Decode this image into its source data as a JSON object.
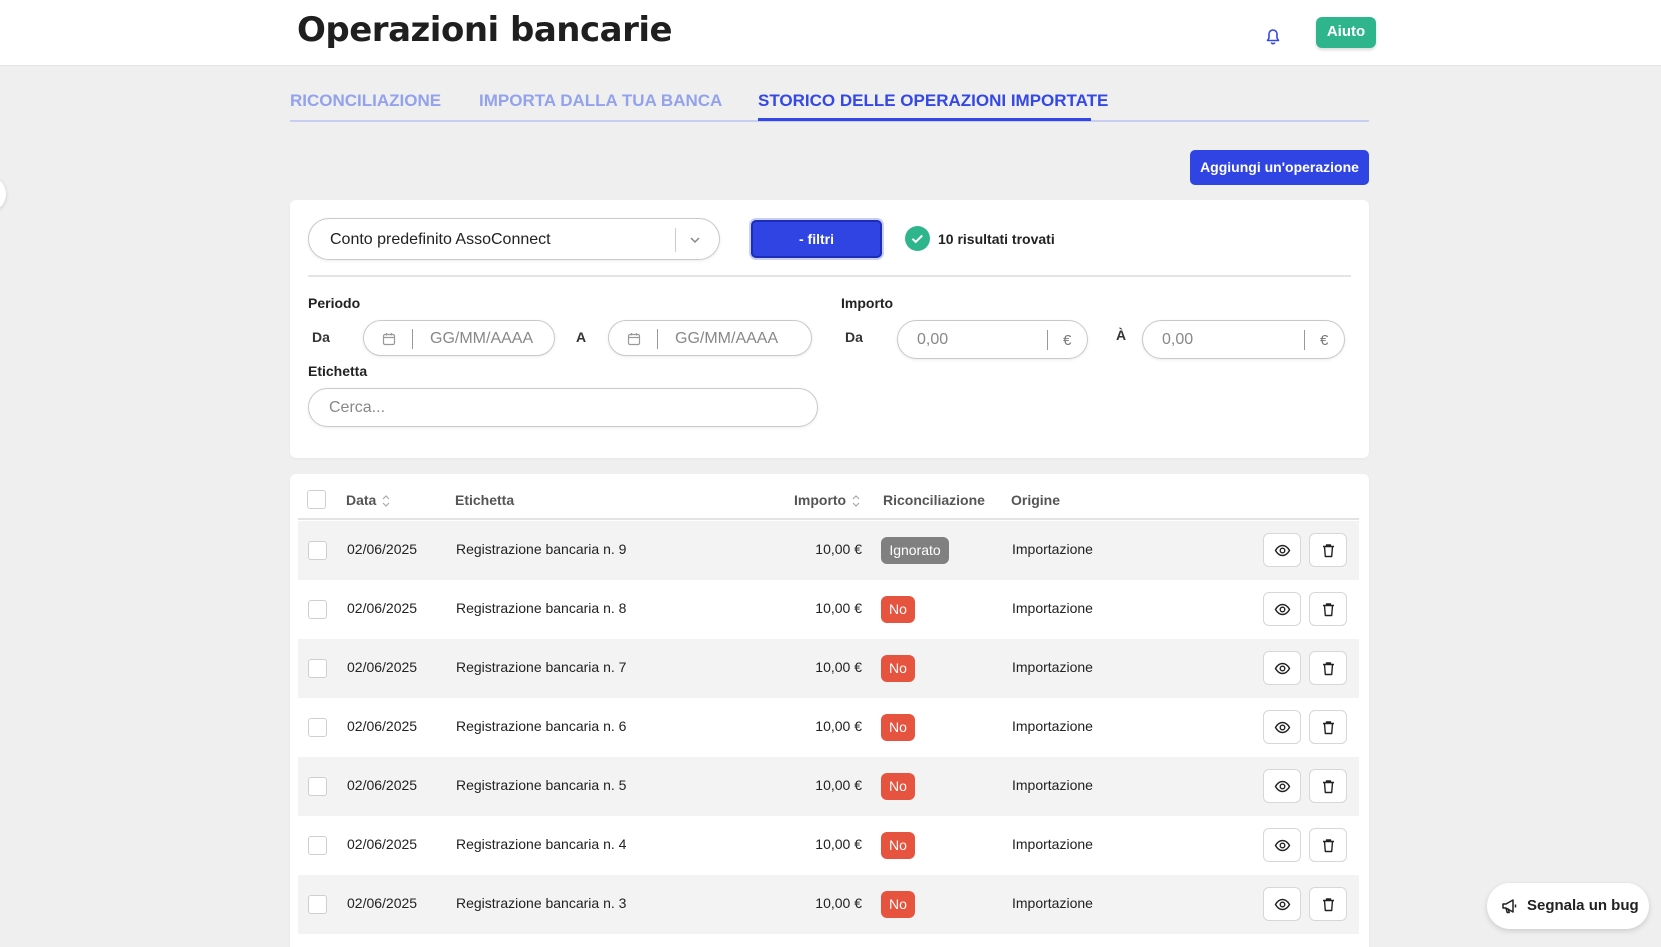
{
  "header": {
    "title": "Operazioni bancarie",
    "help_label": "Aiuto"
  },
  "tabs": [
    {
      "label": "RICONCILIAZIONE",
      "active": false
    },
    {
      "label": "IMPORTA DALLA TUA BANCA",
      "active": false
    },
    {
      "label": "STORICO DELLE OPERAZIONI IMPORTATE",
      "active": true
    }
  ],
  "actions": {
    "add_operation_label": "Aggiungi un'operazione"
  },
  "filters": {
    "account_selected": "Conto predefinito AssoConnect",
    "toggle_label": "- filtri",
    "results_text": "10 risultati trovati",
    "period_label": "Periodo",
    "from_label": "Da",
    "to_label": "A",
    "date_placeholder": "GG/MM/AAAA",
    "amount_label": "Importo",
    "amount_from_label": "Da",
    "amount_to_label": "À",
    "amount_placeholder": "0,00",
    "currency": "€",
    "tag_label": "Etichetta",
    "tag_placeholder": "Cerca..."
  },
  "table": {
    "columns": {
      "date": "Data",
      "label": "Etichetta",
      "amount": "Importo",
      "reconciliation": "Riconciliazione",
      "origin": "Origine"
    },
    "rows": [
      {
        "date": "02/06/2025",
        "label": "Registrazione bancaria n. 9",
        "amount": "10,00 €",
        "status": "Ignorato",
        "status_type": "ignored",
        "origin": "Importazione"
      },
      {
        "date": "02/06/2025",
        "label": "Registrazione bancaria n. 8",
        "amount": "10,00 €",
        "status": "No",
        "status_type": "no",
        "origin": "Importazione"
      },
      {
        "date": "02/06/2025",
        "label": "Registrazione bancaria n. 7",
        "amount": "10,00 €",
        "status": "No",
        "status_type": "no",
        "origin": "Importazione"
      },
      {
        "date": "02/06/2025",
        "label": "Registrazione bancaria n. 6",
        "amount": "10,00 €",
        "status": "No",
        "status_type": "no",
        "origin": "Importazione"
      },
      {
        "date": "02/06/2025",
        "label": "Registrazione bancaria n. 5",
        "amount": "10,00 €",
        "status": "No",
        "status_type": "no",
        "origin": "Importazione"
      },
      {
        "date": "02/06/2025",
        "label": "Registrazione bancaria n. 4",
        "amount": "10,00 €",
        "status": "No",
        "status_type": "no",
        "origin": "Importazione"
      },
      {
        "date": "02/06/2025",
        "label": "Registrazione bancaria n. 3",
        "amount": "10,00 €",
        "status": "No",
        "status_type": "no",
        "origin": "Importazione"
      }
    ]
  },
  "bug_report": {
    "label": "Segnala un bug"
  },
  "colors": {
    "primary": "#2f44e2",
    "success": "#2fb58c",
    "danger": "#e6533f",
    "neutral_badge": "#808080"
  },
  "icons": {
    "bell": "bell-icon",
    "chevron": "chevron-down-icon",
    "check": "check-icon",
    "calendar": "calendar-icon",
    "sort": "sort-icon",
    "view": "eye-icon",
    "delete": "trash-icon",
    "bug": "megaphone-icon"
  }
}
